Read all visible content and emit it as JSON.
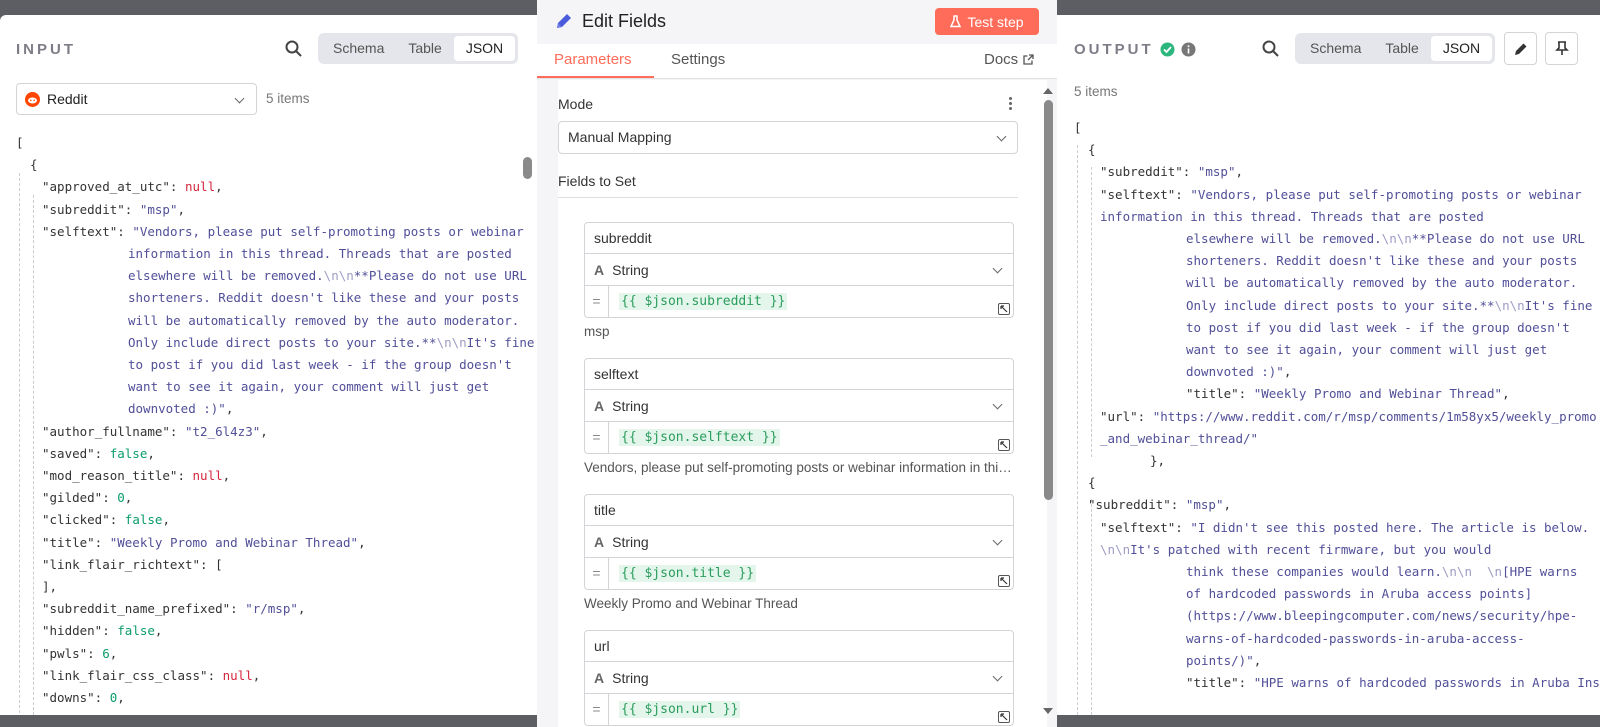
{
  "input": {
    "title": "INPUT",
    "view_tabs": [
      "Schema",
      "Table",
      "JSON"
    ],
    "active_tab": "JSON",
    "source_node": "Reddit",
    "item_count": "5 items",
    "json_lines": [
      [
        [
          "p",
          "["
        ]
      ],
      [
        [
          "p",
          "{"
        ]
      ],
      [
        [
          "k",
          "\"approved_at_utc\": "
        ],
        [
          "n",
          "null"
        ],
        [
          "p",
          ","
        ]
      ],
      [
        [
          "k",
          "\"subreddit\": "
        ],
        [
          "s",
          "\"msp\""
        ],
        [
          "p",
          ","
        ]
      ],
      [
        [
          "k",
          "\"selftext\": "
        ],
        [
          "s",
          "\"Vendors, please put self-promoting posts or webinar"
        ]
      ],
      [
        [
          "s",
          "information in this thread. Threads that are posted"
        ]
      ],
      [
        [
          "s",
          "elsewhere will be removed."
        ],
        [
          "e",
          "\\n\\n"
        ],
        [
          "s",
          "**Please do not use URL"
        ]
      ],
      [
        [
          "s",
          "shorteners. Reddit doesn't like these and your posts"
        ]
      ],
      [
        [
          "s",
          "will be automatically removed by the auto moderator."
        ]
      ],
      [
        [
          "s",
          "Only include direct posts to your site.**"
        ],
        [
          "e",
          "\\n\\n"
        ],
        [
          "s",
          "It's fine"
        ]
      ],
      [
        [
          "s",
          "to post if you did last week - if the group doesn't"
        ]
      ],
      [
        [
          "s",
          "want to see it again, your comment will just get"
        ]
      ],
      [
        [
          "s",
          "downvoted :)\""
        ],
        [
          "p",
          ","
        ]
      ],
      [
        [
          "k",
          "\"author_fullname\": "
        ],
        [
          "s",
          "\"t2_6l4z3\""
        ],
        [
          "p",
          ","
        ]
      ],
      [
        [
          "k",
          "\"saved\": "
        ],
        [
          "b",
          "false"
        ],
        [
          "p",
          ","
        ]
      ],
      [
        [
          "k",
          "\"mod_reason_title\": "
        ],
        [
          "n",
          "null"
        ],
        [
          "p",
          ","
        ]
      ],
      [
        [
          "k",
          "\"gilded\": "
        ],
        [
          "b",
          "0"
        ],
        [
          "p",
          ","
        ]
      ],
      [
        [
          "k",
          "\"clicked\": "
        ],
        [
          "b",
          "false"
        ],
        [
          "p",
          ","
        ]
      ],
      [
        [
          "k",
          "\"title\": "
        ],
        [
          "s",
          "\"Weekly Promo and Webinar Thread\""
        ],
        [
          "p",
          ","
        ]
      ],
      [
        [
          "k",
          "\"link_flair_richtext\": "
        ],
        [
          "p",
          "["
        ]
      ],
      [
        [
          "p",
          "],"
        ]
      ],
      [
        [
          "k",
          "\"subreddit_name_prefixed\": "
        ],
        [
          "s",
          "\"r/msp\""
        ],
        [
          "p",
          ","
        ]
      ],
      [
        [
          "k",
          "\"hidden\": "
        ],
        [
          "b",
          "false"
        ],
        [
          "p",
          ","
        ]
      ],
      [
        [
          "k",
          "\"pwls\": "
        ],
        [
          "b",
          "6"
        ],
        [
          "p",
          ","
        ]
      ],
      [
        [
          "k",
          "\"link_flair_css_class\": "
        ],
        [
          "n",
          "null"
        ],
        [
          "p",
          ","
        ]
      ],
      [
        [
          "k",
          "\"downs\": "
        ],
        [
          "b",
          "0"
        ],
        [
          "p",
          ","
        ]
      ]
    ]
  },
  "node": {
    "title": "Edit Fields",
    "test_button": "Test step",
    "tabs": [
      "Parameters",
      "Settings"
    ],
    "active_tab": "Parameters",
    "docs_link": "Docs",
    "mode_label": "Mode",
    "mode_value": "Manual Mapping",
    "fields_label": "Fields to Set",
    "fields": [
      {
        "name": "subreddit",
        "type": "String",
        "expression": "{{ $json.subreddit }}",
        "result": "msp"
      },
      {
        "name": "selftext",
        "type": "String",
        "expression": "{{ $json.selftext }}",
        "result": "Vendors, please put self-promoting posts or webinar information in this thread. Threads that are posted elsewhere will be removed."
      },
      {
        "name": "title",
        "type": "String",
        "expression": "{{ $json.title }}",
        "result": "Weekly Promo and Webinar Thread"
      },
      {
        "name": "url",
        "type": "String",
        "expression": "{{ $json.url }}",
        "result": ""
      }
    ]
  },
  "output": {
    "title": "OUTPUT",
    "view_tabs": [
      "Schema",
      "Table",
      "JSON"
    ],
    "active_tab": "JSON",
    "item_count": "5 items",
    "json_lines": [
      [
        [
          "p",
          "["
        ]
      ],
      [
        [
          "p",
          "{"
        ]
      ],
      [
        [
          "k",
          "\"subreddit\": "
        ],
        [
          "s",
          "\"msp\""
        ],
        [
          "p",
          ","
        ]
      ],
      [
        [
          "k",
          "\"selftext\": "
        ],
        [
          "s",
          "\"Vendors, please put self-promoting posts or webinar"
        ]
      ],
      [
        [
          "s",
          "information in this thread. Threads that are posted"
        ]
      ],
      [
        [
          "s",
          "elsewhere will be removed."
        ],
        [
          "e",
          "\\n\\n"
        ],
        [
          "s",
          "**Please do not use URL"
        ]
      ],
      [
        [
          "s",
          "shorteners. Reddit doesn't like these and your posts"
        ]
      ],
      [
        [
          "s",
          "will be automatically removed by the auto moderator."
        ]
      ],
      [
        [
          "s",
          "Only include direct posts to your site.**"
        ],
        [
          "e",
          "\\n\\n"
        ],
        [
          "s",
          "It's fine"
        ]
      ],
      [
        [
          "s",
          "to post if you did last week - if the group doesn't"
        ]
      ],
      [
        [
          "s",
          "want to see it again, your comment will just get"
        ]
      ],
      [
        [
          "s",
          "downvoted :)\""
        ],
        [
          "p",
          ","
        ]
      ],
      [
        [
          "k",
          "\"title\": "
        ],
        [
          "s",
          "\"Weekly Promo and Webinar Thread\""
        ],
        [
          "p",
          ","
        ]
      ],
      [
        [
          "k",
          "\"url\": "
        ],
        [
          "s",
          "\"https://www.reddit.com/r/msp/comments/1m58yx5/weekly_promo"
        ]
      ],
      [
        [
          "s",
          "_and_webinar_thread/\""
        ]
      ],
      [
        [
          "p",
          "},"
        ]
      ],
      [
        [
          "p",
          "{"
        ]
      ],
      [
        [
          "k",
          "\"subreddit\": "
        ],
        [
          "s",
          "\"msp\""
        ],
        [
          "p",
          ","
        ]
      ],
      [
        [
          "k",
          "\"selftext\": "
        ],
        [
          "s",
          "\"I didn't see this posted here. The article is below."
        ]
      ],
      [
        [
          "e",
          "\\n\\n"
        ],
        [
          "s",
          "It's patched with recent firmware, but you would"
        ]
      ],
      [
        [
          "s",
          "think these companies would learn."
        ],
        [
          "e",
          "\\n\\n  \\n"
        ],
        [
          "s",
          "[HPE warns"
        ]
      ],
      [
        [
          "s",
          "of hardcoded passwords in Aruba access points]"
        ]
      ],
      [
        [
          "s",
          "(https://www.bleepingcomputer.com/news/security/hpe-"
        ]
      ],
      [
        [
          "s",
          "warns-of-hardcoded-passwords-in-aruba-access-"
        ]
      ],
      [
        [
          "s",
          "points/)\""
        ],
        [
          "p",
          ","
        ]
      ],
      [
        [
          "k",
          "\"title\": "
        ],
        [
          "s",
          "\"HPE warns of hardcoded passwords in Aruba Instant On"
        ]
      ]
    ]
  },
  "colors": {
    "accent": "#ff6d5a",
    "pencil": "#4a5bdc",
    "success": "#2cb67d",
    "reddit": "#ff4500"
  }
}
